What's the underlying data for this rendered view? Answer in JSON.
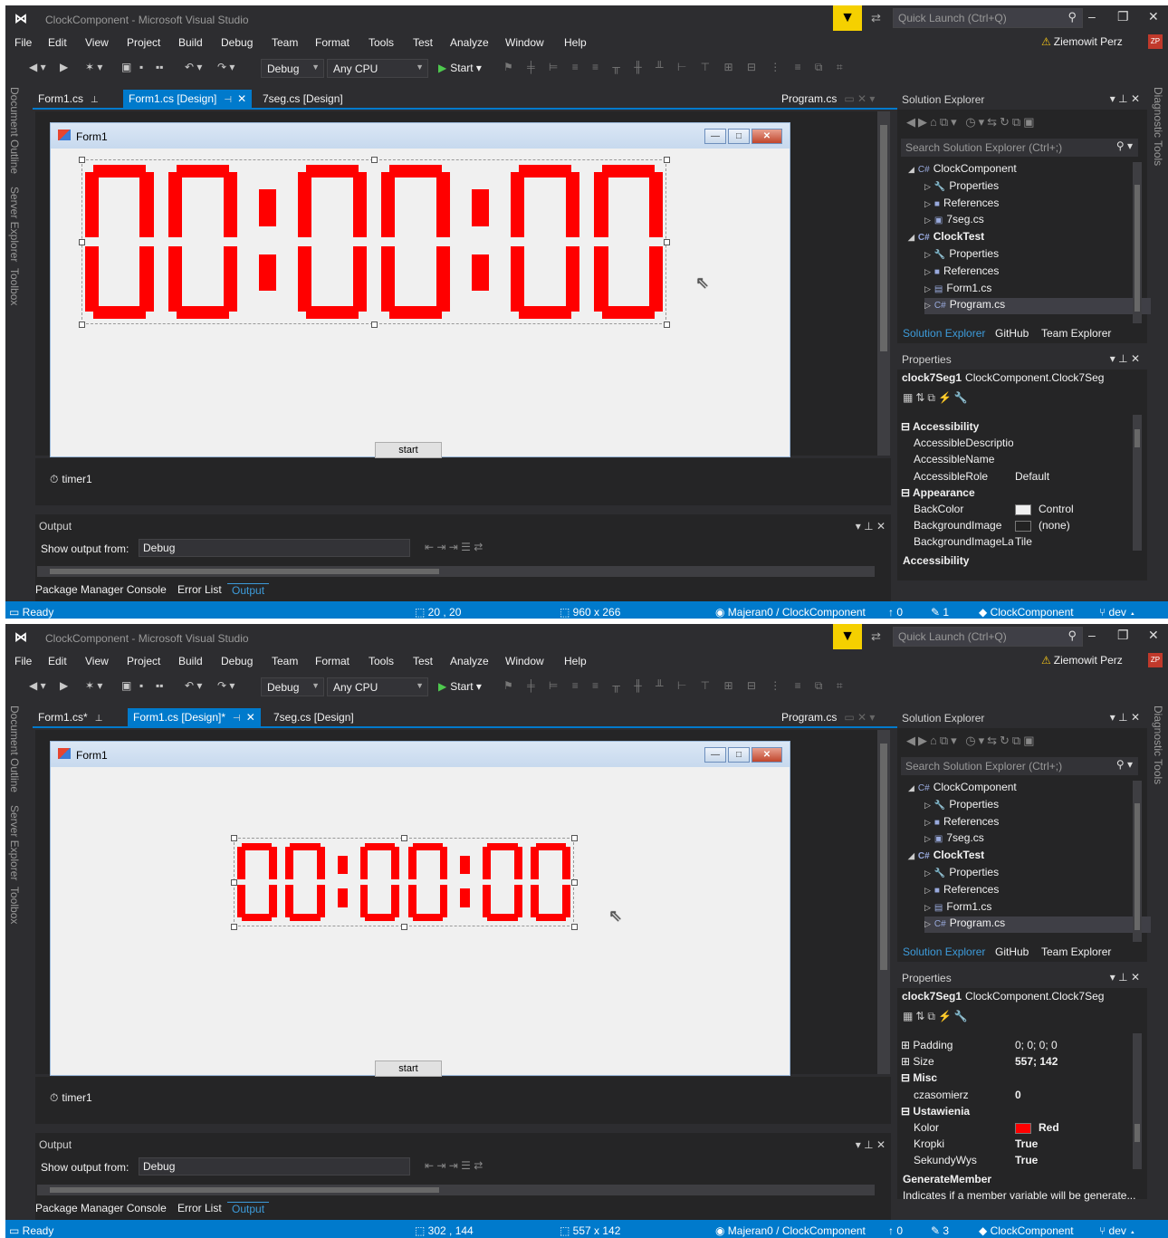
{
  "window": {
    "title": "ClockComponent - Microsoft Visual Studio",
    "quick_launch_placeholder": "Quick Launch (Ctrl+Q)",
    "user": "Ziemowit Perz",
    "user_initials": "ZP"
  },
  "menu": [
    "File",
    "Edit",
    "View",
    "Project",
    "Build",
    "Debug",
    "Team",
    "Format",
    "Tools",
    "Test",
    "Analyze",
    "Window",
    "Help"
  ],
  "toolbar": {
    "config": "Debug",
    "platform": "Any CPU",
    "start_label": "Start"
  },
  "side_tabs": [
    "Document Outline",
    "Server Explorer",
    "Toolbox"
  ],
  "right_tab": "Diagnostic Tools",
  "solution_explorer": {
    "title": "Solution Explorer",
    "search_placeholder": "Search Solution Explorer (Ctrl+;)",
    "tree": [
      {
        "label": "ClockComponent",
        "bold": false
      },
      {
        "label": "Properties"
      },
      {
        "label": "References"
      },
      {
        "label": "7seg.cs"
      },
      {
        "label": "ClockTest",
        "bold": true
      },
      {
        "label": "Properties"
      },
      {
        "label": "References"
      },
      {
        "label": "Form1.cs"
      },
      {
        "label": "Program.cs"
      }
    ],
    "tabs": [
      "Solution Explorer",
      "GitHub",
      "Team Explorer"
    ]
  },
  "properties_title": "Properties",
  "selected_object": {
    "name": "clock7Seg1",
    "type": "ClockComponent.Clock7Seg"
  },
  "form": {
    "title": "Form1",
    "start_button": "start"
  },
  "tray": {
    "timer": "timer1"
  },
  "clock_display": "00:00:00",
  "output": {
    "title": "Output",
    "show_from_label": "Show output from:",
    "source": "Debug",
    "tabs": [
      "Package Manager Console",
      "Error List",
      "Output"
    ]
  },
  "status_common": {
    "ready": "Ready",
    "repo": "Majeran0 / ClockComponent",
    "up": "0",
    "project": "ClockComponent",
    "branch": "dev"
  },
  "shot1": {
    "tabs": {
      "form1_cs": "Form1.cs",
      "form1_design": "Form1.cs [Design]",
      "seg_design": "7seg.cs [Design]",
      "program": "Program.cs"
    },
    "status": {
      "position": "20 , 20",
      "size": "960 x 266",
      "pencil": "1"
    },
    "properties": [
      {
        "name": "Accessibility",
        "value": "",
        "category": true
      },
      {
        "name": "AccessibleDescription",
        "value": ""
      },
      {
        "name": "AccessibleName",
        "value": ""
      },
      {
        "name": "AccessibleRole",
        "value": "Default"
      },
      {
        "name": "Appearance",
        "value": "",
        "category": true
      },
      {
        "name": "BackColor",
        "value": "Control",
        "swatch": "#f0f0f0"
      },
      {
        "name": "BackgroundImage",
        "value": "(none)",
        "swatch": "#222222"
      },
      {
        "name": "BackgroundImageLayout",
        "value": "Tile"
      }
    ],
    "desc_title": "Accessibility",
    "desc": ""
  },
  "shot2": {
    "tabs": {
      "form1_cs": "Form1.cs*",
      "form1_design": "Form1.cs [Design]*",
      "seg_design": "7seg.cs [Design]",
      "program": "Program.cs"
    },
    "status": {
      "position": "302 , 144",
      "size": "557 x 142",
      "pencil": "3"
    },
    "properties": [
      {
        "name": "Padding",
        "value": "0; 0; 0; 0",
        "expand": true
      },
      {
        "name": "Size",
        "value": "557; 142",
        "expand": true,
        "bold": true
      },
      {
        "name": "Misc",
        "value": "",
        "category": true
      },
      {
        "name": "czasomierz",
        "value": "0",
        "bold": true
      },
      {
        "name": "Ustawienia",
        "value": "",
        "category": true
      },
      {
        "name": "Kolor",
        "value": "Red",
        "swatch": "#ff0000",
        "bold": true
      },
      {
        "name": "Kropki",
        "value": "True",
        "bold": true
      },
      {
        "name": "SekundyWys",
        "value": "True",
        "bold": true
      }
    ],
    "desc_title": "GenerateMember",
    "desc": "Indicates if a member variable will be generate..."
  },
  "colors": {
    "accent": "#007acc",
    "segment": "#ff0000",
    "ide_bg": "#2d2d30"
  }
}
